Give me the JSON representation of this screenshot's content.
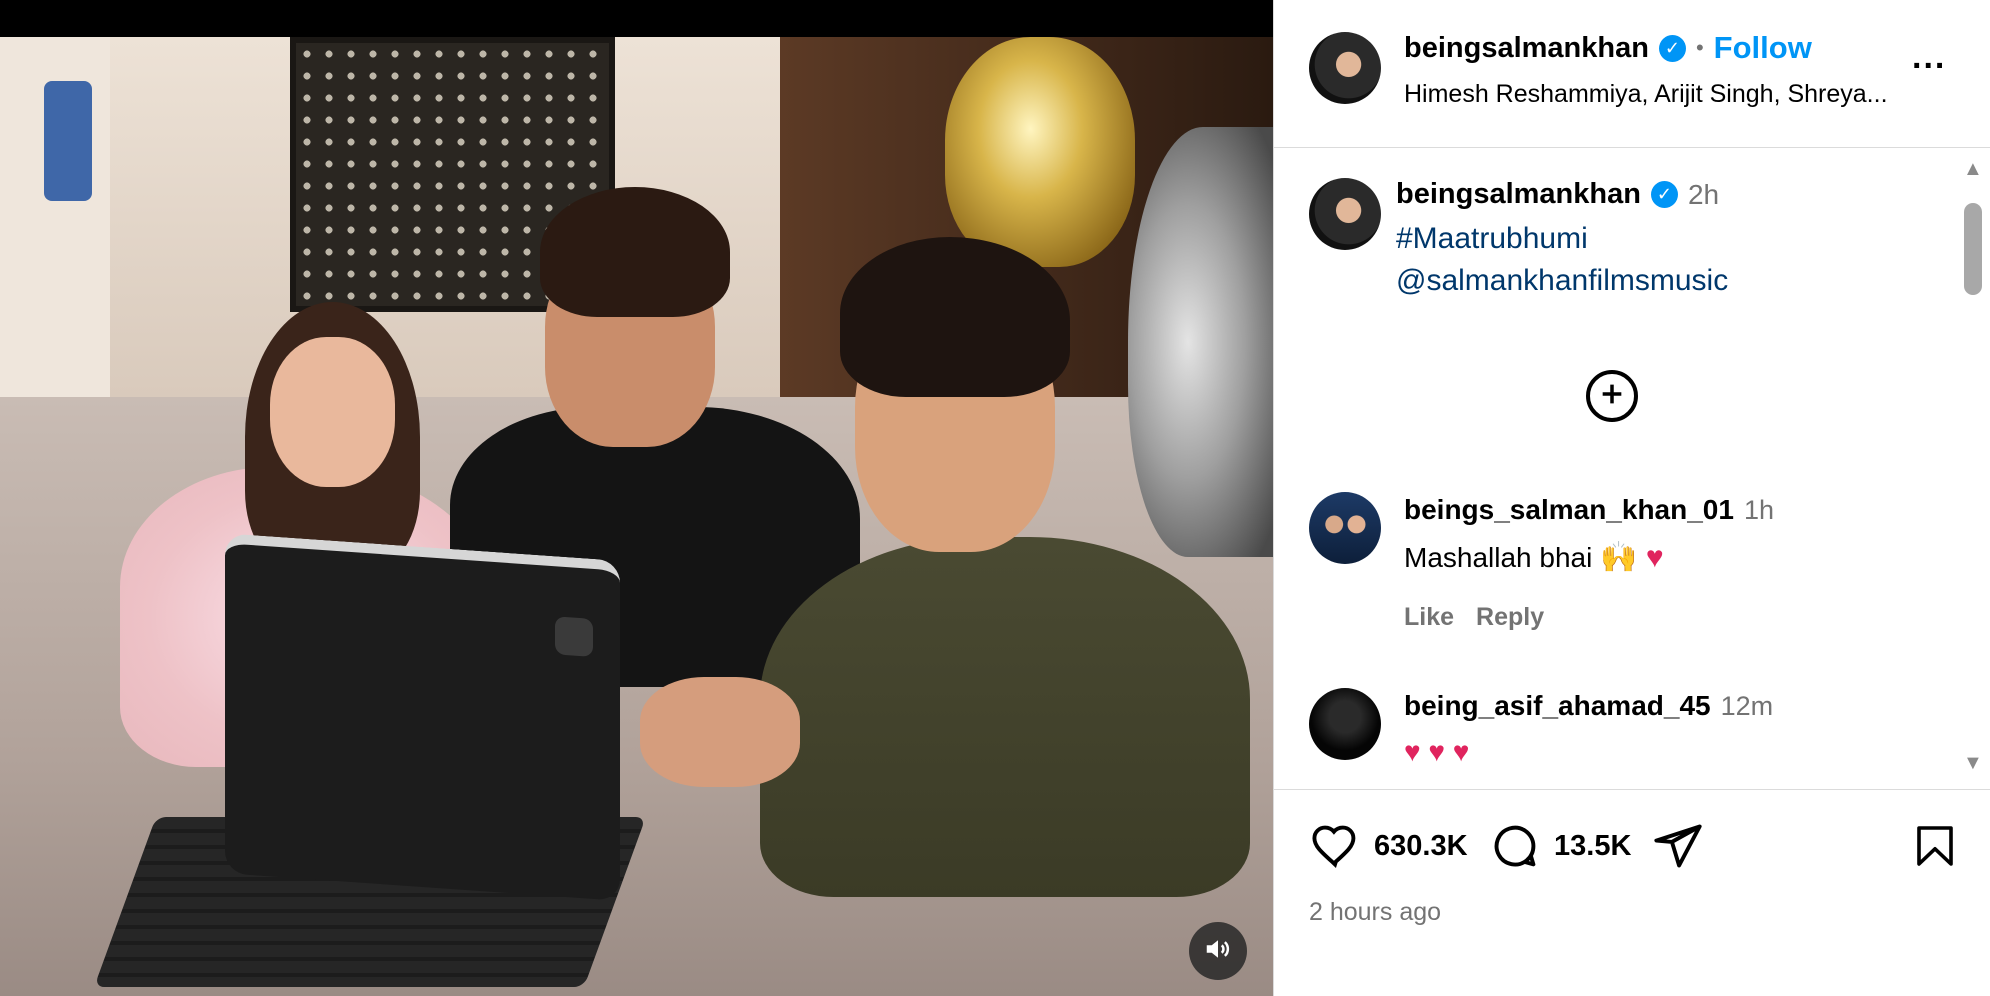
{
  "post": {
    "username": "beingsalmankhan",
    "verified_mark": "✓",
    "separator": "•",
    "follow_label": "Follow",
    "audio": "Himesh Reshammiya, Arijit Singh, Shreya...",
    "more_label": "..."
  },
  "caption": {
    "username": "beingsalmankhan",
    "time": "2h",
    "hashtag": "#Maatrubhumi",
    "mention": "@salmankhanfilmsmusic"
  },
  "comments": [
    {
      "username": "beings_salman_khan_01",
      "time": "1h",
      "text": "Mashallah bhai",
      "emojis": "🙌 ♥",
      "like_label": "Like",
      "reply_label": "Reply"
    },
    {
      "username": "being_asif_ahamad_45",
      "time": "12m",
      "emojis": "♥ ♥ ♥"
    }
  ],
  "stats": {
    "likes": "630.3K",
    "comments": "13.5K",
    "posted": "2 hours ago"
  },
  "icons": {
    "like": "heart-icon",
    "comment": "comment-icon",
    "share": "share-icon",
    "save": "bookmark-icon",
    "sound": "speaker-icon",
    "add": "plus-circle-icon"
  },
  "colors": {
    "link_blue": "#0095f6",
    "hashtag_blue": "#00376b",
    "muted": "#737373",
    "heart": "#e0245e"
  }
}
